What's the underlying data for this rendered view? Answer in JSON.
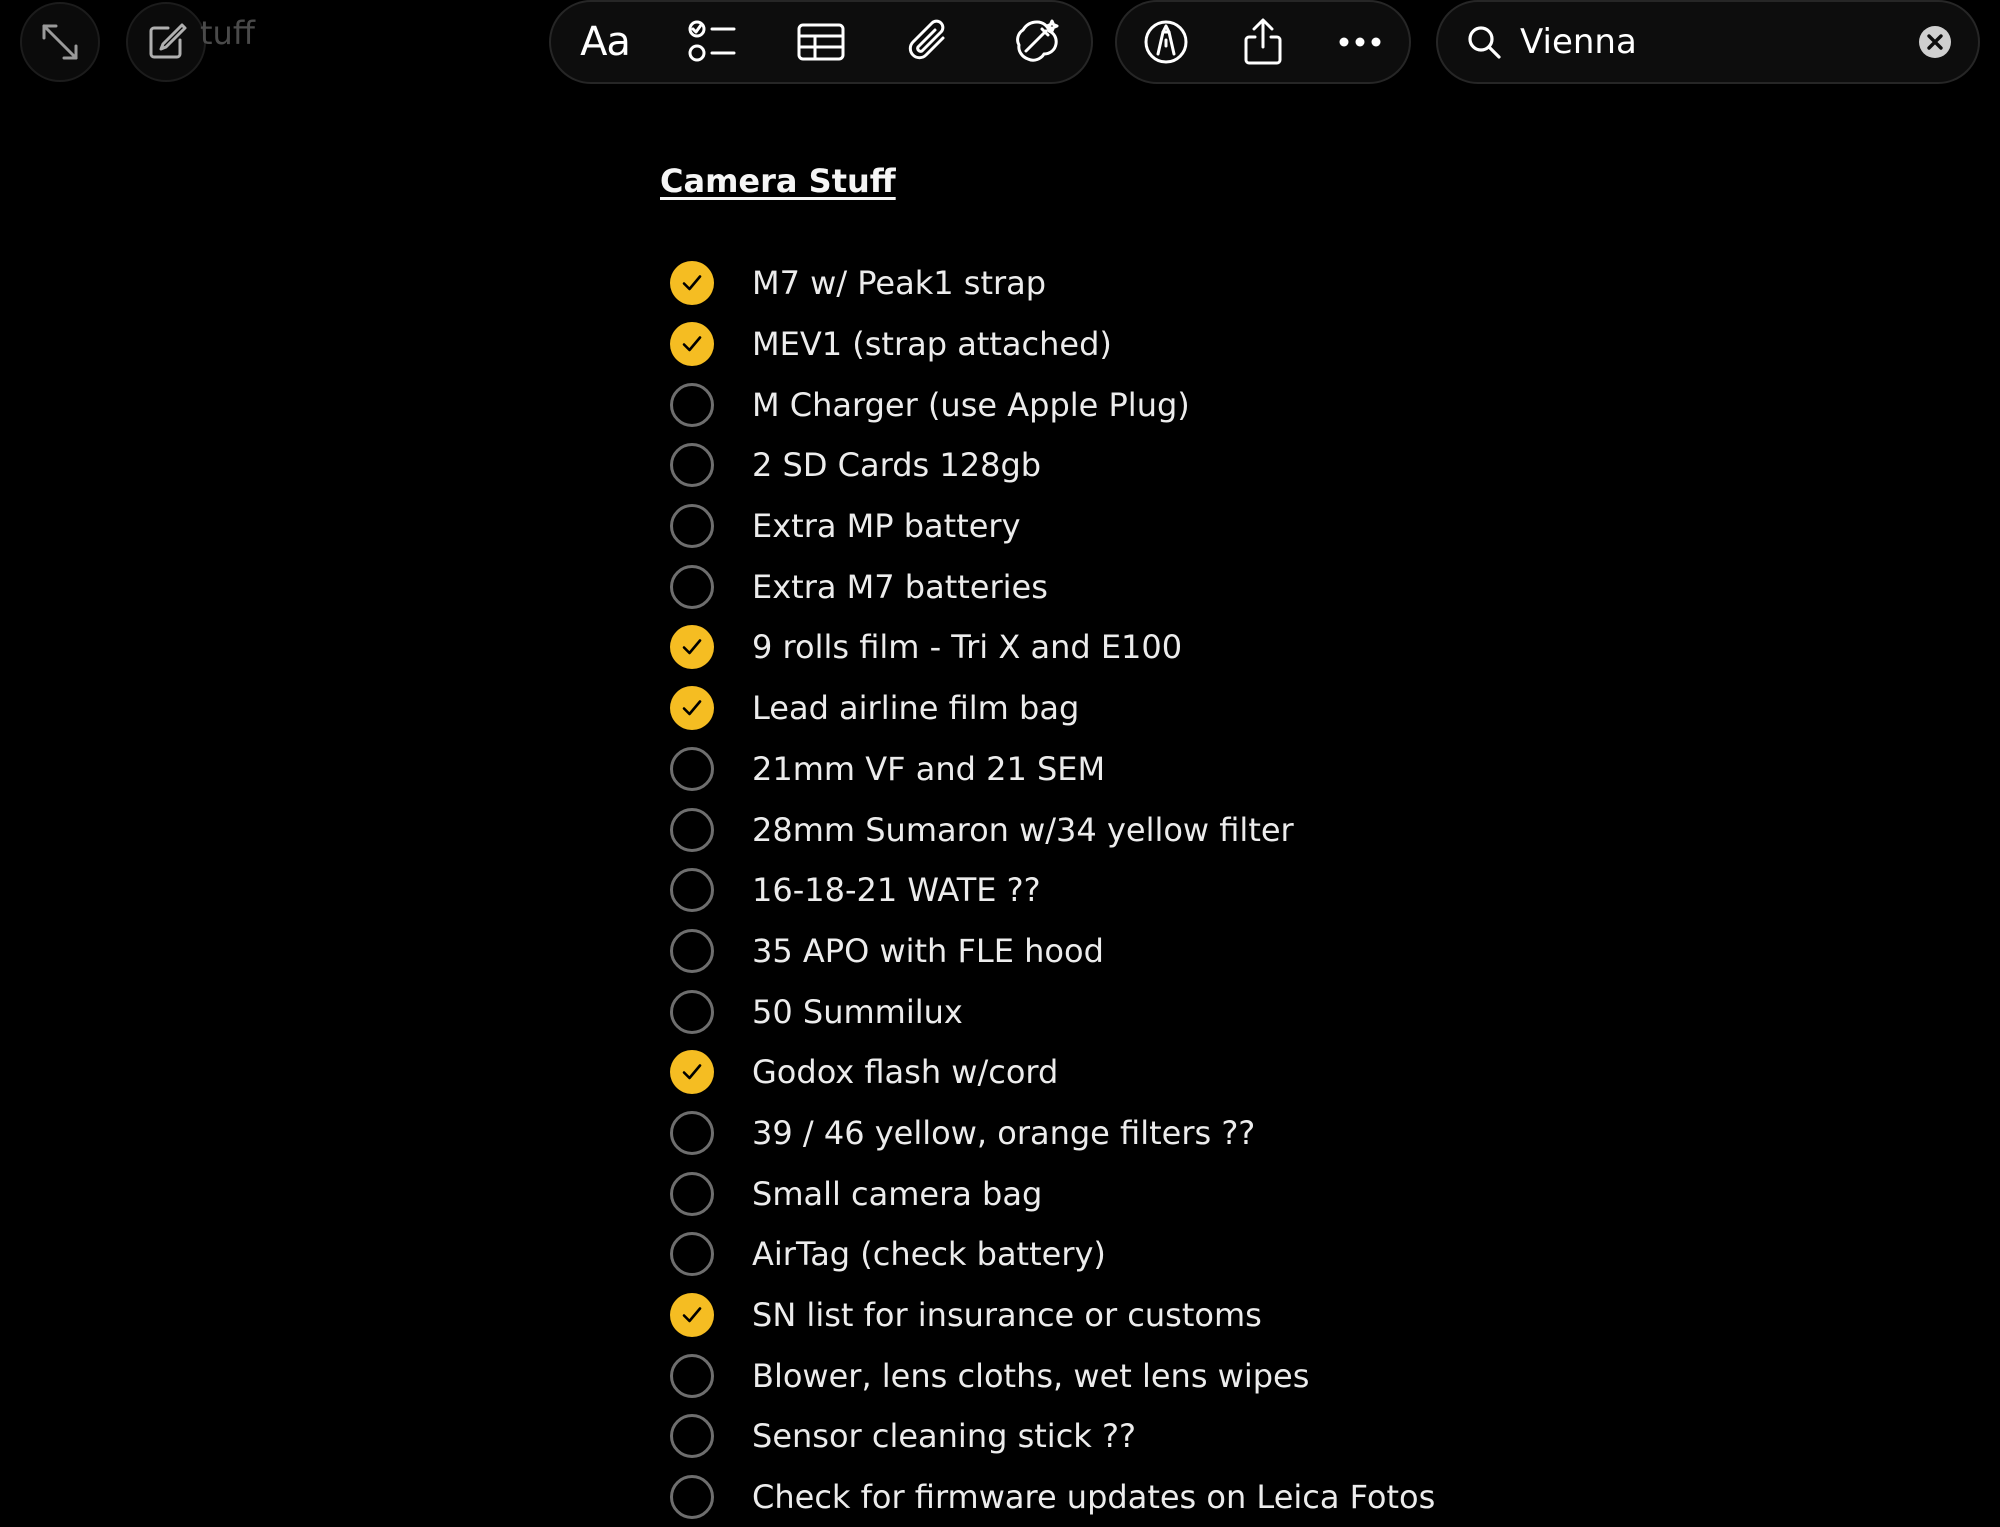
{
  "window": {
    "faded_title": "tuff"
  },
  "toolbar": {
    "format_label": "Aa",
    "icons": {
      "collapse": "collapse-arrows-icon",
      "compose": "compose-icon",
      "checklist": "checklist-icon",
      "table": "table-icon",
      "attachment": "paperclip-icon",
      "apple_intelligence": "writing-tools-icon",
      "markup": "markup-pen-icon",
      "share": "share-icon",
      "more": "more-ellipsis-icon"
    }
  },
  "search": {
    "value": "Vienna",
    "icon": "search-icon",
    "clear_icon": "clear-icon"
  },
  "note": {
    "title": "Camera Stuff",
    "items": [
      {
        "text": "M7 w/ Peak1 strap",
        "checked": true
      },
      {
        "text": "MEV1 (strap attached)",
        "checked": true
      },
      {
        "text": "M Charger (use Apple Plug)",
        "checked": false
      },
      {
        "text": "2 SD Cards 128gb",
        "checked": false
      },
      {
        "text": "Extra MP battery",
        "checked": false
      },
      {
        "text": "Extra M7 batteries",
        "checked": false
      },
      {
        "text": "9 rolls film - Tri X and E100",
        "checked": true
      },
      {
        "text": "Lead airline film bag",
        "checked": true
      },
      {
        "text": "21mm VF and 21 SEM",
        "checked": false
      },
      {
        "text": "28mm Sumaron w/34 yellow filter",
        "checked": false
      },
      {
        "text": "16-18-21 WATE ??",
        "checked": false
      },
      {
        "text": "35 APO with FLE hood",
        "checked": false
      },
      {
        "text": "50 Summilux",
        "checked": false
      },
      {
        "text": "Godox flash w/cord",
        "checked": true
      },
      {
        "text": "39 / 46 yellow, orange filters ??",
        "checked": false
      },
      {
        "text": "Small camera bag",
        "checked": false
      },
      {
        "text": "AirTag (check battery)",
        "checked": false
      },
      {
        "text": "SN list for insurance or customs",
        "checked": true
      },
      {
        "text": "Blower, lens cloths, wet lens wipes",
        "checked": false
      },
      {
        "text": "Sensor cleaning stick ??",
        "checked": false
      },
      {
        "text": "Check for firmware updates on Leica Fotos",
        "checked": false
      }
    ]
  },
  "colors": {
    "background": "#000000",
    "checked_fill": "#f5bd22",
    "text": "#ececec",
    "unchecked_ring": "#6e6e6e"
  }
}
